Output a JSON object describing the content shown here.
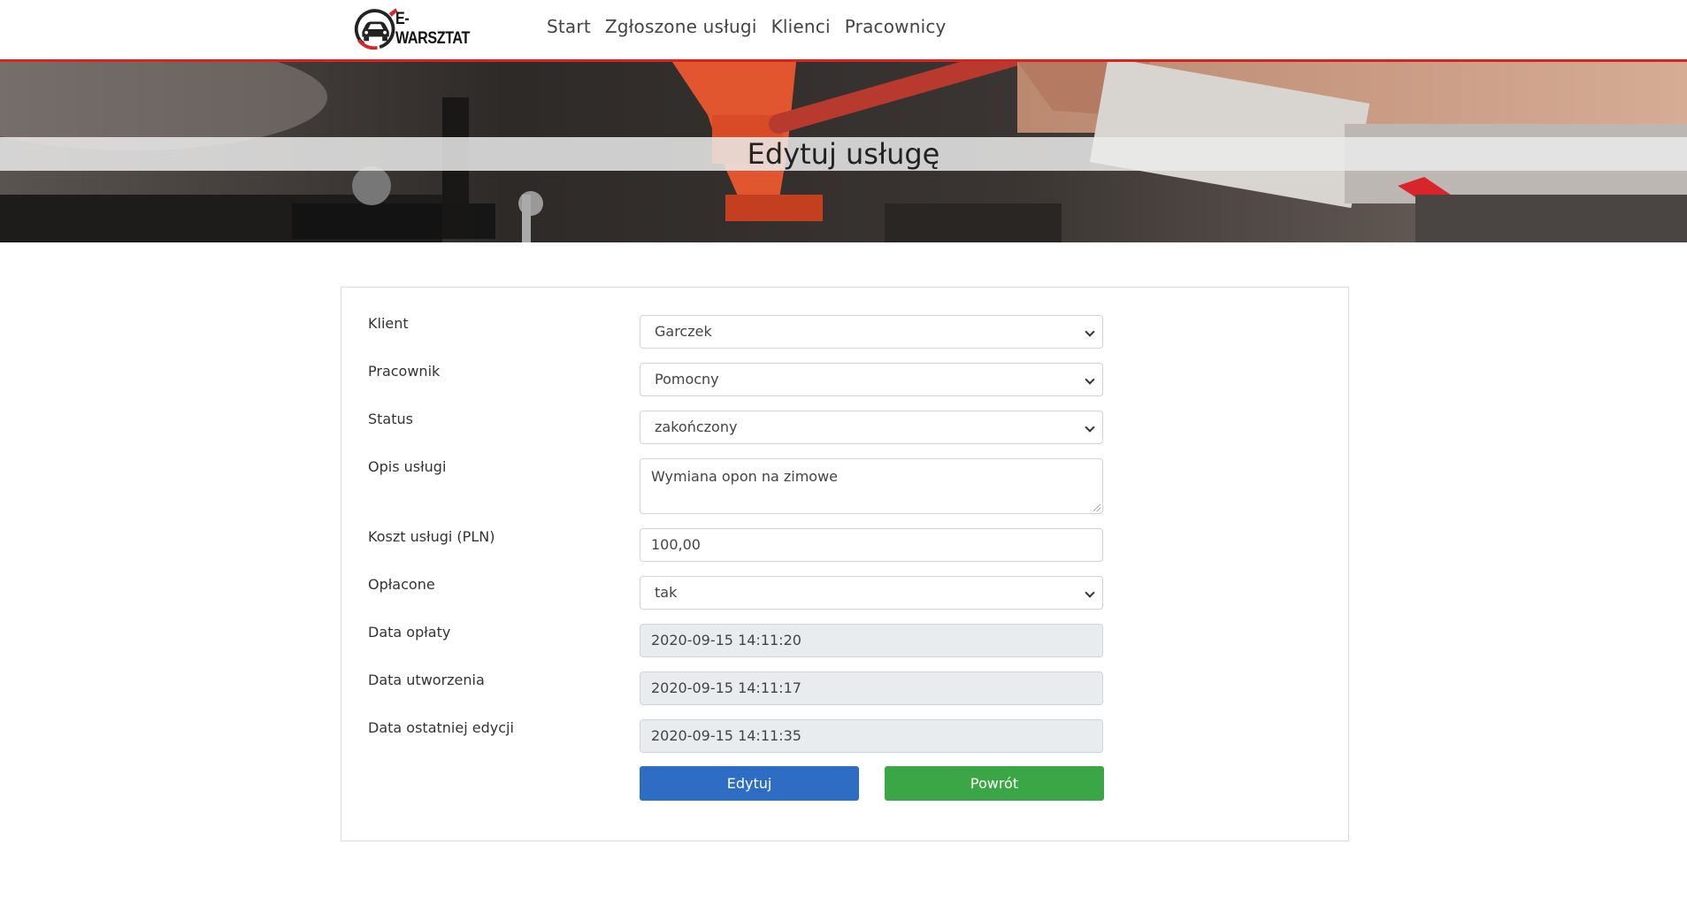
{
  "brand": {
    "name": "E-WARSZTAT",
    "icon": "car-wrench-logo-icon"
  },
  "nav": {
    "items": [
      "Start",
      "Zgłoszone usługi",
      "Klienci",
      "Pracownicy"
    ]
  },
  "banner": {
    "title": "Edytuj usługę"
  },
  "form": {
    "fields": [
      {
        "label": "Klient",
        "value": "Garczek",
        "type": "select"
      },
      {
        "label": "Pracownik",
        "value": "Pomocny",
        "type": "select"
      },
      {
        "label": "Status",
        "value": "zakończony",
        "type": "select"
      },
      {
        "label": "Opis usługi",
        "value": "Wymiana opon na zimowe",
        "type": "textarea"
      },
      {
        "label": "Koszt usługi (PLN)",
        "value": "100,00",
        "type": "text"
      },
      {
        "label": "Opłacone",
        "value": "tak",
        "type": "select"
      },
      {
        "label": "Data opłaty",
        "value": "2020-09-15 14:11:20",
        "type": "readonly"
      },
      {
        "label": "Data utworzenia",
        "value": "2020-09-15 14:11:17",
        "type": "readonly"
      },
      {
        "label": "Data ostatniej edycji",
        "value": "2020-09-15 14:11:35",
        "type": "readonly"
      }
    ],
    "buttons": {
      "edit": "Edytuj",
      "back": "Powrót"
    }
  },
  "colors": {
    "accent": "#e0201b",
    "edit_button": "#2d6dc4",
    "back_button": "#3aa646",
    "readonly_bg": "#e9ecef"
  }
}
